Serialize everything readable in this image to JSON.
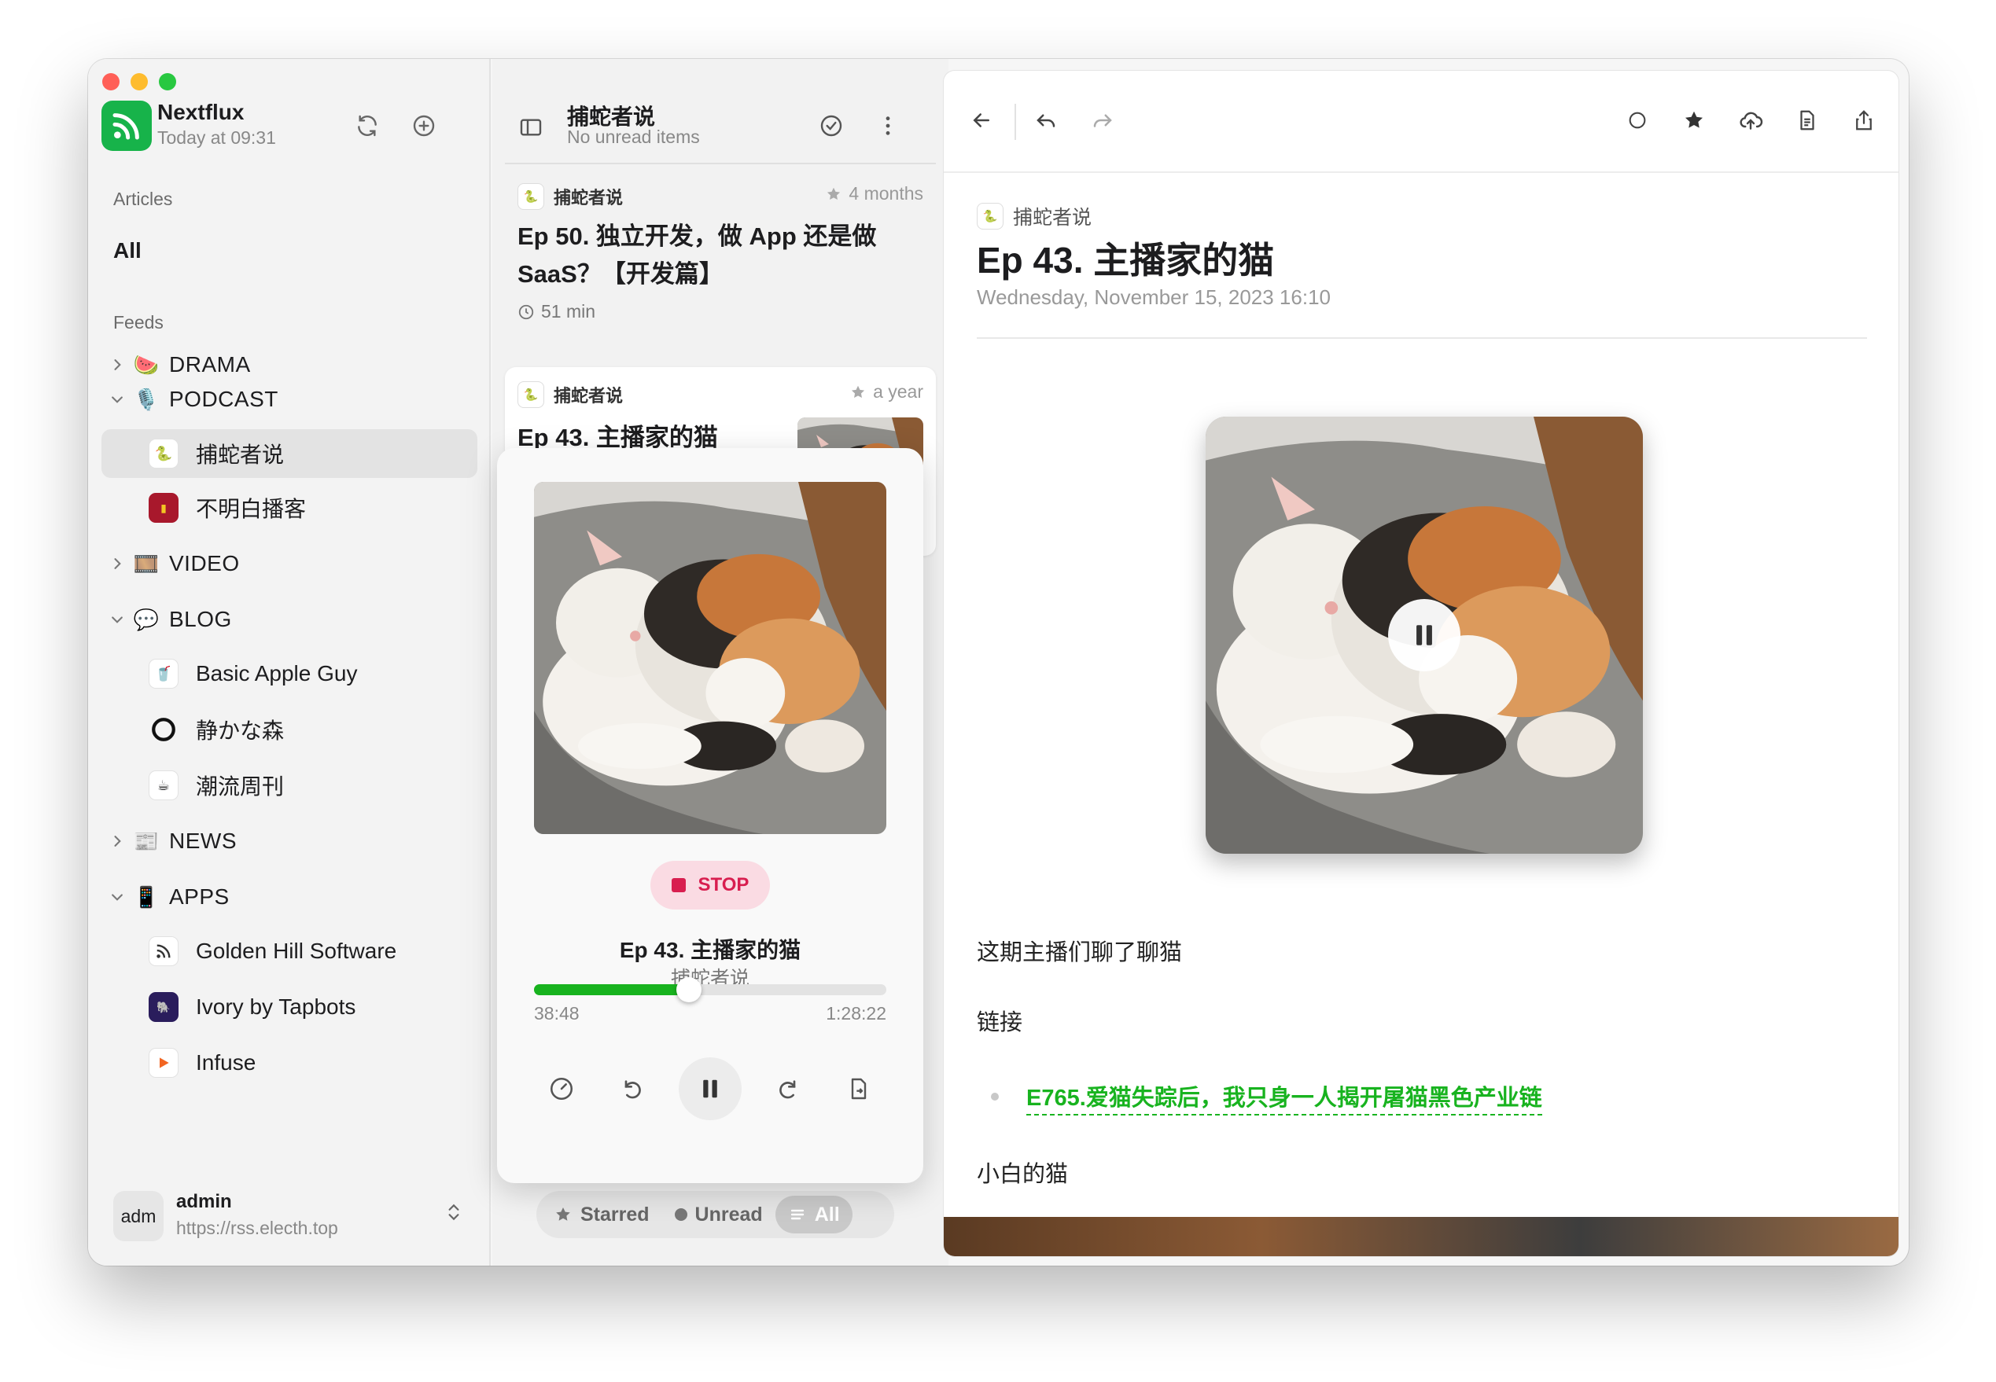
{
  "app": {
    "name": "Nextflux",
    "subtitle": "Today at 09:31"
  },
  "sidebar": {
    "articles_label": "Articles",
    "all_label": "All",
    "feeds_label": "Feeds",
    "groups": [
      {
        "label": "DRAMA",
        "emoji": "🍉",
        "expanded": false
      },
      {
        "label": "PODCAST",
        "emoji": "🎙️",
        "expanded": true
      },
      {
        "label": "VIDEO",
        "emoji": "🎞️",
        "expanded": false
      },
      {
        "label": "BLOG",
        "emoji": "💬",
        "expanded": true
      },
      {
        "label": "NEWS",
        "emoji": "📰",
        "expanded": false
      },
      {
        "label": "APPS",
        "emoji": "📱",
        "expanded": true
      }
    ],
    "feeds": [
      {
        "label": "捕蛇者说",
        "group": "PODCAST",
        "selected": true
      },
      {
        "label": "不明白播客",
        "group": "PODCAST"
      },
      {
        "label": "Basic Apple Guy",
        "group": "BLOG"
      },
      {
        "label": "静かな森",
        "group": "BLOG"
      },
      {
        "label": "潮流周刊",
        "group": "BLOG"
      },
      {
        "label": "Golden Hill Software",
        "group": "APPS"
      },
      {
        "label": "Ivory by Tapbots",
        "group": "APPS"
      },
      {
        "label": "Infuse",
        "group": "APPS"
      }
    ],
    "user": {
      "avatar": "adm",
      "name": "admin",
      "url": "https://rss.electh.top"
    }
  },
  "list": {
    "title": "捕蛇者说",
    "subtitle": "No unread items",
    "articles": [
      {
        "feed": "捕蛇者说",
        "time": "4 months",
        "title": "Ep 50. 独立开发，做 App 还是做 SaaS？【开发篇】",
        "duration": "51 min",
        "starred": true
      },
      {
        "feed": "捕蛇者说",
        "time": "a year",
        "title": "Ep 43. 主播家的猫",
        "starred": true
      }
    ],
    "filters": [
      {
        "label": "Starred",
        "icon": "star-icon"
      },
      {
        "label": "Unread",
        "icon": "dot-icon"
      },
      {
        "label": "All",
        "icon": "list-icon",
        "active": true
      }
    ]
  },
  "player": {
    "stop_label": "STOP",
    "title": "Ep 43. 主播家的猫",
    "feed": "捕蛇者说",
    "elapsed": "38:48",
    "total": "1:28:22",
    "progress_fraction": 0.44,
    "accent": "#18b31f"
  },
  "reader": {
    "feed": "捕蛇者说",
    "title": "Ep 43. 主播家的猫",
    "date": "Wednesday, November 15, 2023 16:10",
    "paragraphs": [
      "这期主播们聊了聊猫",
      "链接",
      "小白的猫"
    ],
    "link_text": "E765.爱猫失踪后，我只身一人揭开屠猫黑色产业链",
    "link_color": "#18b31f"
  }
}
